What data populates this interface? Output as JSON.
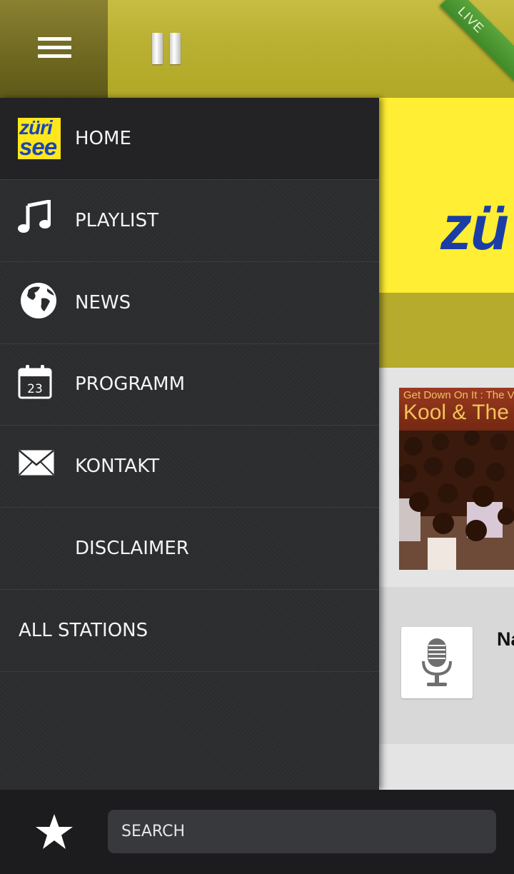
{
  "top_bar": {
    "menu_icon": "hamburger-icon",
    "pause_icon": "pause-icon",
    "live_badge": "LIVE"
  },
  "drawer": {
    "items": [
      {
        "label": "HOME",
        "icon": "station-logo",
        "active": true
      },
      {
        "label": "PLAYLIST",
        "icon": "music-note-icon"
      },
      {
        "label": "NEWS",
        "icon": "globe-icon"
      },
      {
        "label": "PROGRAMM",
        "icon": "calendar-icon"
      },
      {
        "label": "KONTAKT",
        "icon": "envelope-icon"
      },
      {
        "label": "DISCLAIMER",
        "icon": ""
      },
      {
        "label": "ALL STATIONS",
        "icon": ""
      }
    ],
    "station_logo_text": [
      "züri",
      "see"
    ],
    "calendar_day": "23"
  },
  "content": {
    "banner_logo_text": "zü",
    "album_title": "Get Down On It : The V",
    "album_artist": "Kool & The",
    "now_playing_text": "Na"
  },
  "bottom_bar": {
    "favorite_icon": "star-icon",
    "search_placeholder": "SEARCH"
  },
  "colors": {
    "top_bar": "#b9b032",
    "menu_button": "#6e6720",
    "drawer_bg": "#2b2c2e",
    "banner_yellow": "#ffee33",
    "live_ribbon": "#4f9a33",
    "bottom_bar": "#1c1c1e"
  }
}
